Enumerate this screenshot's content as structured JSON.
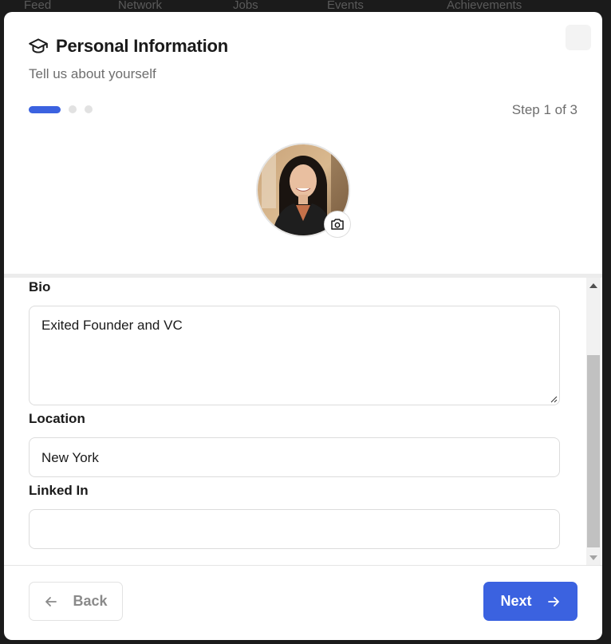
{
  "background_nav": {
    "items": [
      "Feed",
      "Network",
      "Jobs",
      "Events",
      "Achievements"
    ]
  },
  "modal": {
    "title": "Personal Information",
    "subtitle": "Tell us about yourself",
    "step_text": "Step 1 of 3",
    "current_step": 1,
    "total_steps": 3,
    "accent_color": "#3b62e0"
  },
  "form": {
    "bio_label": "Bio",
    "bio_value": "Exited Founder and VC",
    "location_label": "Location",
    "location_value": "New York",
    "linkedin_label": "Linked In",
    "linkedin_value": ""
  },
  "footer": {
    "back_label": "Back",
    "next_label": "Next"
  },
  "icons": {
    "title": "graduation-cap-icon",
    "camera": "camera-icon",
    "back": "arrow-left-icon",
    "next": "arrow-right-icon"
  }
}
